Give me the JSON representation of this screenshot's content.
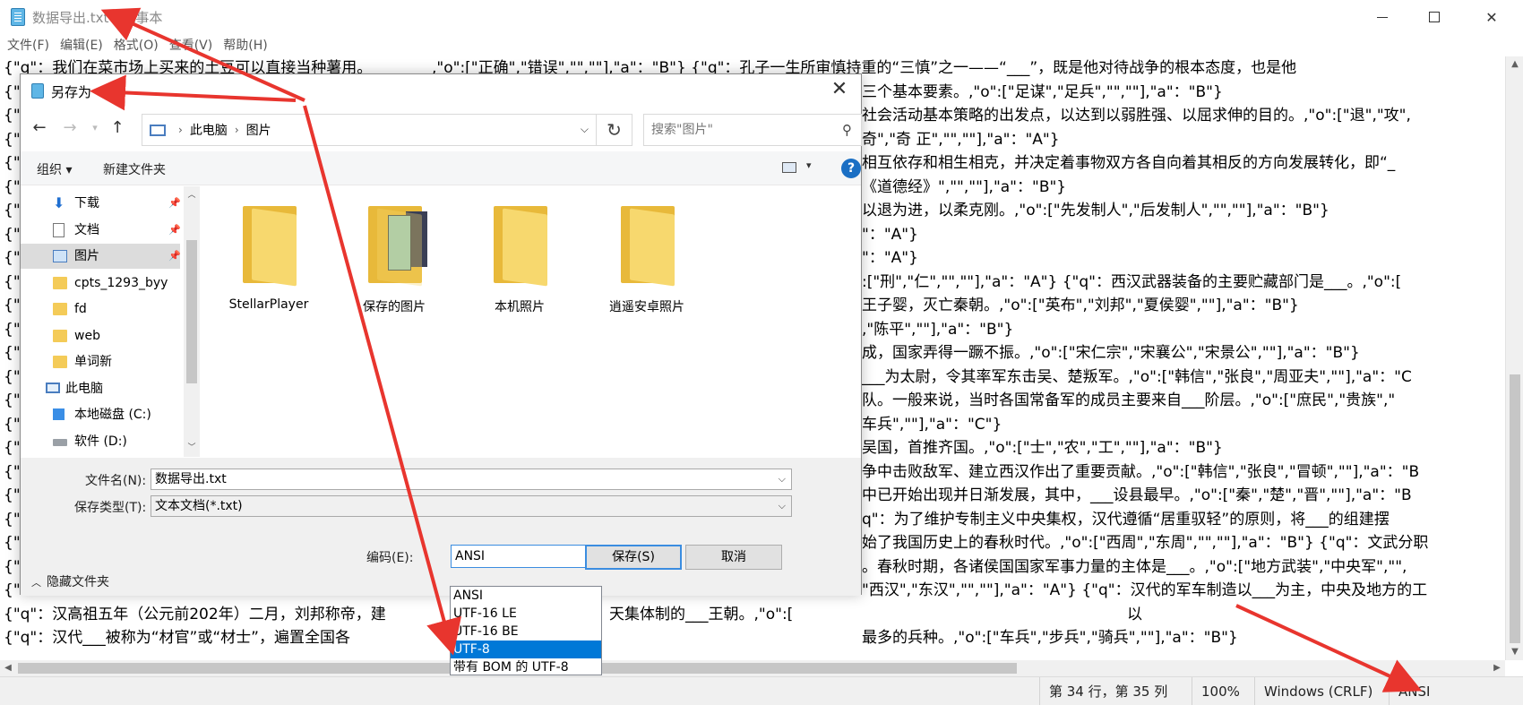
{
  "window": {
    "title": "数据导出.txt - 记事本"
  },
  "menu": [
    "文件(F)",
    "编辑(E)",
    "格式(O)",
    "查看(V)",
    "帮助(H)"
  ],
  "editor_lines": [
    "{\"q\"：我们在菜市场上买来的土豆可以直接当种薯用。",
    "{\"",
    "{\"",
    "{\"",
    "{\"",
    "{\"",
    "{\"",
    "{\"",
    "{\"",
    "{\"",
    "{\"",
    "{\"",
    "{\"",
    "{\"",
    "{\"",
    "{\"",
    "{\"",
    "{\"",
    "{\"",
    "{\"",
    "{\"",
    "{\"",
    "{\"",
    "{\"q\"：汉高祖五年（公元前202年）二月，刘邦称帝，建",
    "{\"q\"：汉代___被称为“材官”或“材士”，遍置全国各"
  ],
  "editor_right_lines": [
    ",\"o\":[\"正确\",\"错误\",\"\",\"\"],\"a\"：\"B\"} {\"q\"：孔子一生所审慎持重的“三慎”之一——“___”，既是他对待战争的根本态度，也是他",
    "三个基本要素。,\"o\":[\"足谋\",\"足兵\",\"\",\"\"],\"a\"：\"B\"}",
    "社会活动基本策略的出发点，以达到以弱胜强、以屈求伸的目的。,\"o\":[\"退\",\"攻\",",
    "奇\",\"奇 正\",\"\",\"\"],\"a\"：\"A\"}",
    "相互依存和相生相克，并决定着事物双方各自向着其相反的方向发展转化，即“_",
    "《道德经》\",\"\",\"\"],\"a\"：\"B\"}",
    "以退为进，以柔克刚。,\"o\":[\"先发制人\",\"后发制人\",\"\",\"\"],\"a\"：\"B\"}",
    "\"：\"A\"}",
    "\"：\"A\"}",
    ":[\"刑\",\"仁\",\"\",\"\"],\"a\"：\"A\"} {\"q\"：西汉武器装备的主要贮藏部门是___。,\"o\":[",
    "王子婴，灭亡秦朝。,\"o\":[\"英布\",\"刘邦\",\"夏侯婴\",\"\"],\"a\"：\"B\"}",
    ",\"陈平\",\"\"],\"a\"：\"B\"}",
    "成，国家弄得一蹶不振。,\"o\":[\"宋仁宗\",\"宋襄公\",\"宋景公\",\"\"],\"a\"：\"B\"}",
    "___为太尉，令其率军东击吴、楚叛军。,\"o\":[\"韩信\",\"张良\",\"周亚夫\",\"\"],\"a\"：\"C",
    "队。一般来说，当时各国常备军的成员主要来自___阶层。,\"o\":[\"庶民\",\"贵族\",\"",
    "车兵\",\"\"],\"a\"：\"C\"}",
    "吴国，首推齐国。,\"o\":[\"士\",\"农\",\"工\",\"\"],\"a\"：\"B\"}",
    "争中击败敌军、建立西汉作出了重要贡献。,\"o\":[\"韩信\",\"张良\",\"冒顿\",\"\"],\"a\"：\"B",
    "中已开始出现并日渐发展，其中，___设县最早。,\"o\":[\"秦\",\"楚\",\"晋\",\"\"],\"a\"：\"B",
    "q\"：为了维护专制主义中央集权，汉代遵循“居重驭轻”的原则，将___的组建摆",
    "始了我国历史上的春秋时代。,\"o\":[\"西周\",\"东周\",\"\",\"\"],\"a\"：\"B\"} {\"q\"：文武分职",
    "。春秋时期，各诸侯国国家军事力量的主体是___。,\"o\":[\"地方武装\",\"中央军\",\"\",",
    "\"西汉\",\"东汉\",\"\",\"\"],\"a\"：\"A\"} {\"q\"：汉代的军车制造以___为主，中央及地方的工",
    "最多的兵种。,\"o\":[\"车兵\",\"步兵\",\"骑兵\",\"\"],\"a\"：\"B\"}"
  ],
  "extra_text": {
    "line23_tail": "天集体制的___王朝。,\"o\":[",
    "line24_mid": "以"
  },
  "statusbar": {
    "position": "第 34 行，第 35 列",
    "zoom": "100%",
    "line_ending": "Windows (CRLF)",
    "encoding": "ANSI"
  },
  "dialog": {
    "title": "另存为",
    "address_root": "此电脑",
    "address_current": "图片",
    "search_placeholder": "搜索\"图片\"",
    "organize": "组织 ▾",
    "new_folder": "新建文件夹",
    "help": "?",
    "tree": [
      {
        "label": "下载",
        "icon": "download-icon",
        "pinned": true
      },
      {
        "label": "文档",
        "icon": "document-icon",
        "pinned": true
      },
      {
        "label": "图片",
        "icon": "pictures-icon",
        "pinned": true,
        "selected": true
      },
      {
        "label": "cpts_1293_byy",
        "icon": "folder-icon"
      },
      {
        "label": "fd",
        "icon": "folder-icon"
      },
      {
        "label": "web",
        "icon": "folder-icon"
      },
      {
        "label": "单词新",
        "icon": "folder-icon"
      },
      {
        "label": "此电脑",
        "icon": "computer-icon"
      },
      {
        "label": "本地磁盘 (C:)",
        "icon": "windows-drive-icon"
      },
      {
        "label": "软件 (D:)",
        "icon": "drive-icon"
      }
    ],
    "files": [
      "StellarPlayer",
      "保存的图片",
      "本机照片",
      "逍遥安卓照片"
    ],
    "filename_label": "文件名(N):",
    "filename_value": "数据导出.txt",
    "filetype_label": "保存类型(T):",
    "filetype_value": "文本文档(*.txt)",
    "hide_folders": "隐藏文件夹",
    "encoding_label": "编码(E):",
    "encoding_value": "ANSI",
    "save": "保存(S)",
    "cancel": "取消"
  },
  "encoding_options": [
    "ANSI",
    "UTF-16 LE",
    "UTF-16 BE",
    "UTF-8",
    "带有 BOM 的 UTF-8"
  ],
  "encoding_highlighted": "UTF-8",
  "annotation_color": "#e8352e"
}
